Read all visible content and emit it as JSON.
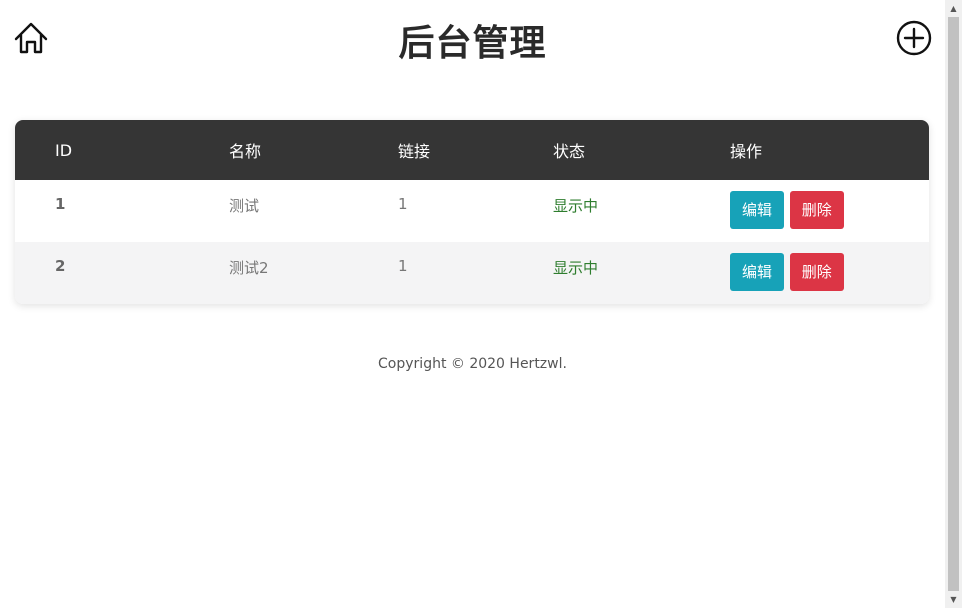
{
  "header": {
    "title": "后台管理",
    "home_icon": "home-icon",
    "add_icon": "plus-circle-icon"
  },
  "table": {
    "columns": [
      "ID",
      "名称",
      "链接",
      "状态",
      "操作"
    ],
    "rows": [
      {
        "id": "1",
        "name": "测试",
        "link": "1",
        "status": "显示中",
        "edit": "编辑",
        "delete": "删除"
      },
      {
        "id": "2",
        "name": "测试2",
        "link": "1",
        "status": "显示中",
        "edit": "编辑",
        "delete": "删除"
      }
    ]
  },
  "footer": {
    "text": "Copyright © 2020 Hertzwl."
  },
  "colors": {
    "header_bg": "#353535",
    "edit": "#17a2b8",
    "delete": "#dc3545",
    "status": "#2e7d2e"
  }
}
